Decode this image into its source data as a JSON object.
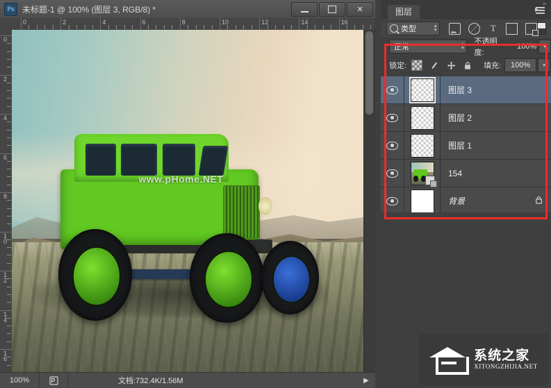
{
  "window": {
    "app_badge": "Ps",
    "title": "未标题-1 @ 100% (图层 3, RGB/8) *",
    "minimize_label": "最小化",
    "maximize_label": "最大化",
    "close_label": "✕"
  },
  "rulers": {
    "unit_hint": "cm",
    "horizontal_labels": [
      "0",
      "2",
      "4",
      "6",
      "8",
      "10",
      "12",
      "14",
      "16"
    ],
    "vertical_labels": [
      "0",
      "2",
      "4",
      "6",
      "8",
      "10",
      "12",
      "14",
      "16"
    ]
  },
  "canvas": {
    "watermark": "www.pHome.NET",
    "subject": "green-jeep-wrangler-in-desert"
  },
  "statusbar": {
    "zoom": "100%",
    "doc_icon": "document-profile-icon",
    "doc_size": "文档:732.4K/1.56M",
    "arrow": "▶"
  },
  "panel": {
    "tab_label": "图层",
    "menu_icon": "panel-menu-icon",
    "filter": {
      "search_icon": "search-icon",
      "type_label": "类型",
      "stepper": "⬍",
      "icons": [
        {
          "name": "pixel-layer-filter-icon",
          "glyph": ""
        },
        {
          "name": "adjustment-layer-filter-icon",
          "glyph": ""
        },
        {
          "name": "text-layer-filter-icon",
          "glyph": "T"
        },
        {
          "name": "shape-layer-filter-icon",
          "glyph": ""
        },
        {
          "name": "smart-object-filter-icon",
          "glyph": ""
        }
      ],
      "toggle_name": "filter-enable-toggle"
    },
    "blend": {
      "mode": "正常",
      "opacity_label": "不透明度:",
      "opacity_value": "100%",
      "opacity_arrow": "▾"
    },
    "lock": {
      "label": "锁定:",
      "icons": [
        {
          "name": "lock-transparent-pixels-icon",
          "glyph": ""
        },
        {
          "name": "lock-image-pixels-icon",
          "glyph": "✎"
        },
        {
          "name": "lock-position-icon",
          "glyph": "✥"
        },
        {
          "name": "lock-all-icon",
          "glyph": "🔒"
        }
      ],
      "fill_label": "填充:",
      "fill_value": "100%",
      "fill_arrow": "▾"
    },
    "layers": [
      {
        "name": "图层 3",
        "thumb": "transparent",
        "visible": true,
        "selected": true,
        "italic": false,
        "locked": false,
        "smart_object": false
      },
      {
        "name": "图层 2",
        "thumb": "transparent",
        "visible": true,
        "selected": false,
        "italic": false,
        "locked": false,
        "smart_object": false
      },
      {
        "name": "图层 1",
        "thumb": "transparent",
        "visible": true,
        "selected": false,
        "italic": false,
        "locked": false,
        "smart_object": false
      },
      {
        "name": "154",
        "thumb": "photo",
        "visible": true,
        "selected": false,
        "italic": false,
        "locked": false,
        "smart_object": true
      },
      {
        "name": "背景",
        "thumb": "white",
        "visible": true,
        "selected": false,
        "italic": true,
        "locked": true,
        "smart_object": false
      }
    ],
    "lock_glyph": "🔒"
  },
  "annotation": {
    "color": "#ee2b2b",
    "box_label": "layers-panel-highlight"
  },
  "watermark": {
    "cn": "系统之家",
    "en": "XITONGZHIJIA.NET"
  }
}
